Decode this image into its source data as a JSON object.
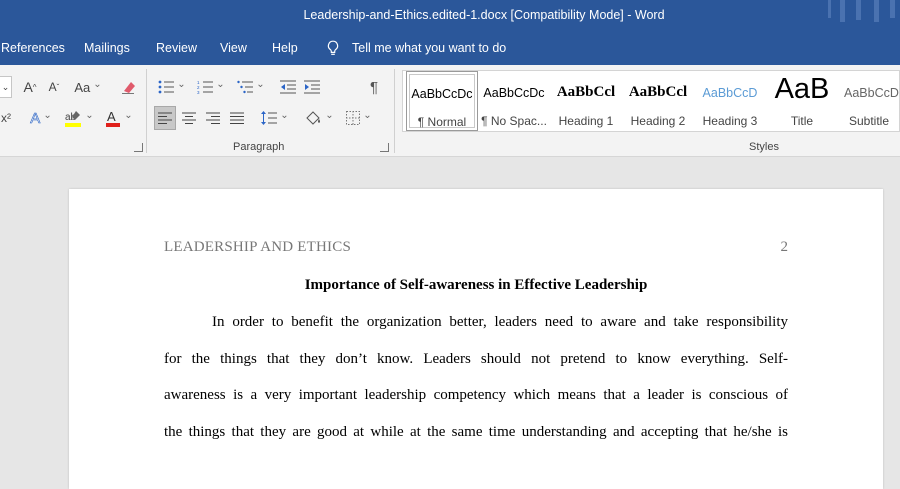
{
  "window": {
    "title": "Leadership-and-Ethics.edited-1.docx [Compatibility Mode]  -  Word",
    "title_bar_color": "#2b579a"
  },
  "tabs": {
    "references": "References",
    "mailings": "Mailings",
    "review": "Review",
    "view": "View",
    "help": "Help",
    "tell_me": "Tell me what you want to do"
  },
  "ribbon": {
    "font_group": {
      "icons": [
        "font-size-increase-icon",
        "font-size-decrease-icon",
        "change-case-icon",
        "clear-formatting-icon",
        "subscript-icon",
        "text-effects-icon",
        "highlight-icon",
        "font-color-icon"
      ]
    },
    "paragraph": {
      "label": "Paragraph",
      "icons": [
        "bullets-icon",
        "numbering-icon",
        "multilevel-list-icon",
        "decrease-indent-icon",
        "increase-indent-icon",
        "show-formatting-marks-icon",
        "align-left-icon",
        "center-icon",
        "align-right-icon",
        "justify-icon",
        "line-spacing-icon",
        "shading-icon",
        "borders-icon"
      ],
      "active": "align-left"
    },
    "styles": {
      "label": "Styles",
      "items": [
        {
          "preview": "AaBbCcDc",
          "label": "¶ Normal"
        },
        {
          "preview": "AaBbCcDc",
          "label": "¶ No Spac..."
        },
        {
          "preview": "AaBbCcl",
          "label": "Heading 1"
        },
        {
          "preview": "AaBbCcl",
          "label": "Heading 2"
        },
        {
          "preview": "AaBbCcD",
          "label": "Heading 3"
        },
        {
          "preview": "AaB",
          "label": "Title"
        },
        {
          "preview": "AaBbCcD",
          "label": "Subtitle"
        }
      ],
      "selected": "¶ Normal",
      "heading3_color": "#5b9bd5"
    }
  },
  "document": {
    "header_left": "LEADERSHIP AND ETHICS",
    "page_number": "2",
    "title": "Importance of Self-awareness in Effective Leadership",
    "lines": [
      "In order to benefit the organization better, leaders need to aware and take responsibility",
      "for the things that they don’t know. Leaders should not pretend to know everything. Self-",
      "awareness is a very important leadership competency which means that a leader is conscious of",
      "the things that they are good at while at the same time understanding and accepting that he/she is"
    ]
  }
}
